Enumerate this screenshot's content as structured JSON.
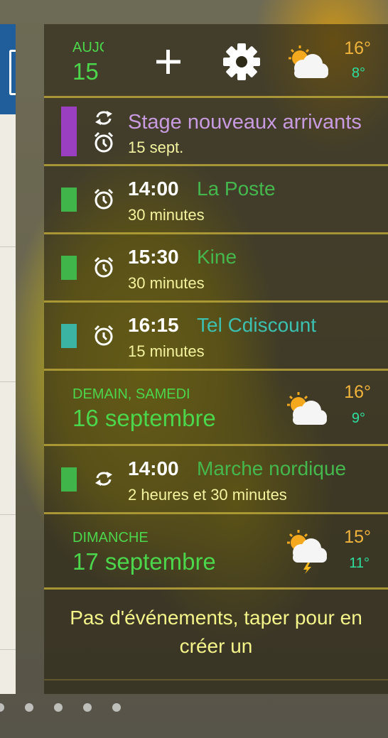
{
  "today": {
    "label": "AUJC",
    "date": "15",
    "add_icon": "plus-icon",
    "settings_icon": "gear-icon",
    "weather_icon": "partly-cloudy-icon",
    "temp_high": "16°",
    "temp_low": "8°"
  },
  "events_today": [
    {
      "time": "",
      "title": "Stage nouveaux arrivants",
      "subtitle": "15 sept.",
      "color": "#9a3fc0",
      "title_color": "#c89ae0",
      "icons": [
        "repeat-icon",
        "alarm-icon"
      ]
    },
    {
      "time": "14:00",
      "title": "La Poste",
      "subtitle": "30 minutes",
      "color": "#3fb54a",
      "title_color": "#45b84d",
      "icons": [
        "alarm-icon"
      ]
    },
    {
      "time": "15:30",
      "title": "Kine",
      "subtitle": "30 minutes",
      "color": "#3fb54a",
      "title_color": "#45b84d",
      "icons": [
        "alarm-icon"
      ]
    },
    {
      "time": "16:15",
      "title": "Tel Cdiscount",
      "subtitle": "15 minutes",
      "color": "#3cb4a4",
      "title_color": "#3cc0b0",
      "icons": [
        "alarm-icon"
      ]
    }
  ],
  "tomorrow": {
    "label": "DEMAIN, SAMEDI",
    "date": "16 septembre",
    "weather_icon": "partly-cloudy-icon",
    "temp_high": "16°",
    "temp_low": "9°"
  },
  "events_tomorrow": [
    {
      "time": "14:00",
      "title": "Marche nordique",
      "subtitle": "2 heures et 30 minutes",
      "color": "#3fb54a",
      "title_color": "#45b84d",
      "icons": [
        "repeat-icon"
      ]
    }
  ],
  "sunday": {
    "label": "DIMANCHE",
    "date": "17 septembre",
    "weather_icon": "thunder-cloud-sun-icon",
    "temp_high": "15°",
    "temp_low": "11°"
  },
  "no_events_text_line1": "Pas d'événements, taper pour en",
  "no_events_text_line2": "créer un",
  "colors": {
    "date_green": "#4cd64c",
    "temp_orange": "#f0b43c",
    "temp_teal": "#2ee0a0",
    "separator": "#b8a43a"
  }
}
